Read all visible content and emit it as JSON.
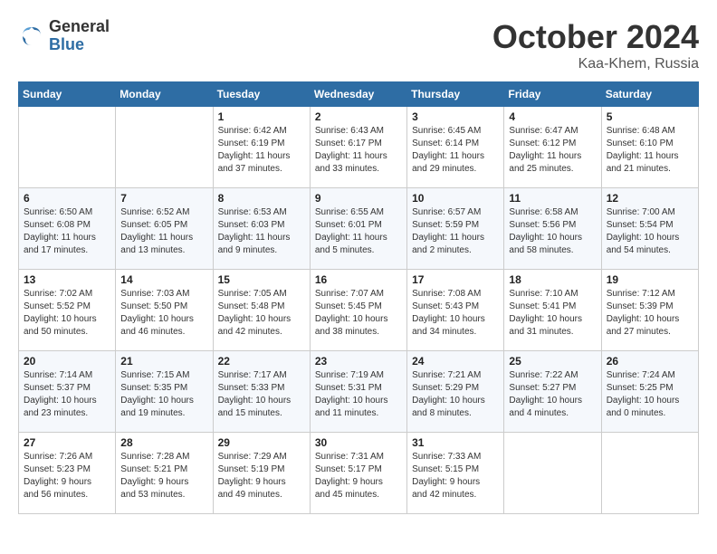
{
  "logo": {
    "general": "General",
    "blue": "Blue"
  },
  "title": "October 2024",
  "location": "Kaa-Khem, Russia",
  "days_of_week": [
    "Sunday",
    "Monday",
    "Tuesday",
    "Wednesday",
    "Thursday",
    "Friday",
    "Saturday"
  ],
  "weeks": [
    [
      {
        "day": "",
        "info": ""
      },
      {
        "day": "",
        "info": ""
      },
      {
        "day": "1",
        "info": "Sunrise: 6:42 AM\nSunset: 6:19 PM\nDaylight: 11 hours\nand 37 minutes."
      },
      {
        "day": "2",
        "info": "Sunrise: 6:43 AM\nSunset: 6:17 PM\nDaylight: 11 hours\nand 33 minutes."
      },
      {
        "day": "3",
        "info": "Sunrise: 6:45 AM\nSunset: 6:14 PM\nDaylight: 11 hours\nand 29 minutes."
      },
      {
        "day": "4",
        "info": "Sunrise: 6:47 AM\nSunset: 6:12 PM\nDaylight: 11 hours\nand 25 minutes."
      },
      {
        "day": "5",
        "info": "Sunrise: 6:48 AM\nSunset: 6:10 PM\nDaylight: 11 hours\nand 21 minutes."
      }
    ],
    [
      {
        "day": "6",
        "info": "Sunrise: 6:50 AM\nSunset: 6:08 PM\nDaylight: 11 hours\nand 17 minutes."
      },
      {
        "day": "7",
        "info": "Sunrise: 6:52 AM\nSunset: 6:05 PM\nDaylight: 11 hours\nand 13 minutes."
      },
      {
        "day": "8",
        "info": "Sunrise: 6:53 AM\nSunset: 6:03 PM\nDaylight: 11 hours\nand 9 minutes."
      },
      {
        "day": "9",
        "info": "Sunrise: 6:55 AM\nSunset: 6:01 PM\nDaylight: 11 hours\nand 5 minutes."
      },
      {
        "day": "10",
        "info": "Sunrise: 6:57 AM\nSunset: 5:59 PM\nDaylight: 11 hours\nand 2 minutes."
      },
      {
        "day": "11",
        "info": "Sunrise: 6:58 AM\nSunset: 5:56 PM\nDaylight: 10 hours\nand 58 minutes."
      },
      {
        "day": "12",
        "info": "Sunrise: 7:00 AM\nSunset: 5:54 PM\nDaylight: 10 hours\nand 54 minutes."
      }
    ],
    [
      {
        "day": "13",
        "info": "Sunrise: 7:02 AM\nSunset: 5:52 PM\nDaylight: 10 hours\nand 50 minutes."
      },
      {
        "day": "14",
        "info": "Sunrise: 7:03 AM\nSunset: 5:50 PM\nDaylight: 10 hours\nand 46 minutes."
      },
      {
        "day": "15",
        "info": "Sunrise: 7:05 AM\nSunset: 5:48 PM\nDaylight: 10 hours\nand 42 minutes."
      },
      {
        "day": "16",
        "info": "Sunrise: 7:07 AM\nSunset: 5:45 PM\nDaylight: 10 hours\nand 38 minutes."
      },
      {
        "day": "17",
        "info": "Sunrise: 7:08 AM\nSunset: 5:43 PM\nDaylight: 10 hours\nand 34 minutes."
      },
      {
        "day": "18",
        "info": "Sunrise: 7:10 AM\nSunset: 5:41 PM\nDaylight: 10 hours\nand 31 minutes."
      },
      {
        "day": "19",
        "info": "Sunrise: 7:12 AM\nSunset: 5:39 PM\nDaylight: 10 hours\nand 27 minutes."
      }
    ],
    [
      {
        "day": "20",
        "info": "Sunrise: 7:14 AM\nSunset: 5:37 PM\nDaylight: 10 hours\nand 23 minutes."
      },
      {
        "day": "21",
        "info": "Sunrise: 7:15 AM\nSunset: 5:35 PM\nDaylight: 10 hours\nand 19 minutes."
      },
      {
        "day": "22",
        "info": "Sunrise: 7:17 AM\nSunset: 5:33 PM\nDaylight: 10 hours\nand 15 minutes."
      },
      {
        "day": "23",
        "info": "Sunrise: 7:19 AM\nSunset: 5:31 PM\nDaylight: 10 hours\nand 11 minutes."
      },
      {
        "day": "24",
        "info": "Sunrise: 7:21 AM\nSunset: 5:29 PM\nDaylight: 10 hours\nand 8 minutes."
      },
      {
        "day": "25",
        "info": "Sunrise: 7:22 AM\nSunset: 5:27 PM\nDaylight: 10 hours\nand 4 minutes."
      },
      {
        "day": "26",
        "info": "Sunrise: 7:24 AM\nSunset: 5:25 PM\nDaylight: 10 hours\nand 0 minutes."
      }
    ],
    [
      {
        "day": "27",
        "info": "Sunrise: 7:26 AM\nSunset: 5:23 PM\nDaylight: 9 hours\nand 56 minutes."
      },
      {
        "day": "28",
        "info": "Sunrise: 7:28 AM\nSunset: 5:21 PM\nDaylight: 9 hours\nand 53 minutes."
      },
      {
        "day": "29",
        "info": "Sunrise: 7:29 AM\nSunset: 5:19 PM\nDaylight: 9 hours\nand 49 minutes."
      },
      {
        "day": "30",
        "info": "Sunrise: 7:31 AM\nSunset: 5:17 PM\nDaylight: 9 hours\nand 45 minutes."
      },
      {
        "day": "31",
        "info": "Sunrise: 7:33 AM\nSunset: 5:15 PM\nDaylight: 9 hours\nand 42 minutes."
      },
      {
        "day": "",
        "info": ""
      },
      {
        "day": "",
        "info": ""
      }
    ]
  ]
}
